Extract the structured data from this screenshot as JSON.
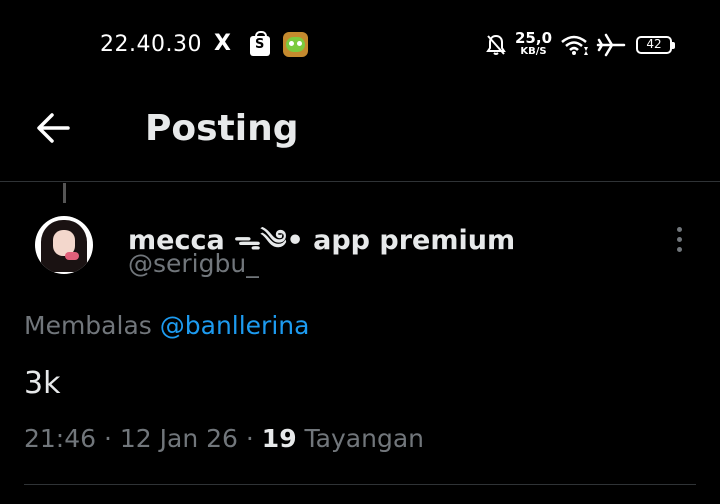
{
  "status_bar": {
    "time": "22.40.30",
    "x_logo": "X",
    "net_speed_value": "25,0",
    "net_speed_unit": "KB/S",
    "battery": "42",
    "icons": [
      "x-logo-icon",
      "shopee-icon",
      "game-app-icon",
      "mute-icon",
      "wifi-icon",
      "airplane-icon",
      "battery-icon"
    ]
  },
  "header": {
    "title": "Posting",
    "back_icon": "arrow-left-icon"
  },
  "tweet": {
    "display_name": "mecca ᯓ༄• app premium",
    "handle": "@serigbu_",
    "reply_prefix": "Membalas",
    "reply_to": "@banllerina",
    "text": "3k",
    "time": "21:46",
    "date": "12 Jan 26",
    "sep": " · ",
    "views_count": "19",
    "views_label": "Tayangan"
  },
  "colors": {
    "background": "#000000",
    "text": "#e7e9ea",
    "muted": "#71767b",
    "link": "#1d9bf0"
  }
}
